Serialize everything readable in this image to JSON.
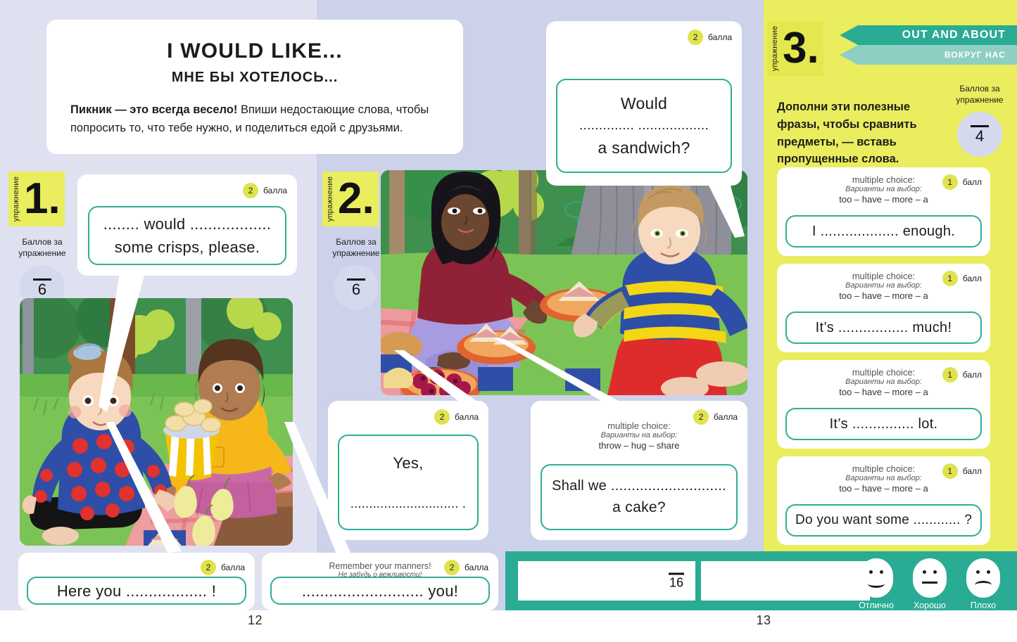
{
  "colors": {
    "bg_left": "#dfe1f0",
    "bg_right": "#ccd2ea",
    "yellow": "#e9ed5e",
    "teal": "#2aab94",
    "teal_light": "#8ecfc4",
    "answer_border": "#2fae96",
    "badge_dot": "#dfe34d",
    "score_circle": "#d5d9ee"
  },
  "pages": {
    "left_number": "12",
    "right_number": "13"
  },
  "title_card": {
    "title_en": "I WOULD LIKE...",
    "title_ru": "МНЕ БЫ ХОТЕЛОСЬ...",
    "body_bold": "Пикник — это всегда весело!",
    "body_rest": " Впиши недостающие слова, чтобы попросить то, что тебе нужно, и поделиться едой с друзьями."
  },
  "exercise1": {
    "vertical_label": "упражнение",
    "number": "1.",
    "caption": "Баллов за упражнение",
    "score_denominator": "6",
    "bubble": {
      "points_value": "2",
      "points_label": "балла",
      "line1": "........  would  ..................",
      "line2": "some crisps, please."
    }
  },
  "exercise2": {
    "vertical_label": "упражнение",
    "number": "2.",
    "caption": "Баллов за упражнение",
    "score_denominator": "6"
  },
  "exercise3": {
    "vertical_label": "упражнение",
    "number": "3.",
    "caption": "Баллов за упражнение",
    "score_denominator": "4",
    "ribbon_en": "OUT AND ABOUT",
    "ribbon_ru": "ВОКРУГ НАС",
    "instruction": "Дополни эти полезные фразы, чтобы сравнить предметы, — вставь пропущенные слова.",
    "cards": [
      {
        "mc_label_en": "multiple choice:",
        "mc_label_ru": "Варианты на выбор:",
        "options": "too – have – more – a",
        "points_value": "1",
        "points_label": "балл",
        "sentence": "I ................... enough."
      },
      {
        "mc_label_en": "multiple choice:",
        "mc_label_ru": "Варианты на выбор:",
        "options": "too – have – more – a",
        "points_value": "1",
        "points_label": "балл",
        "sentence": "It’s  .................  much!"
      },
      {
        "mc_label_en": "multiple choice:",
        "mc_label_ru": "Варианты на выбор:",
        "options": "too – have – more – a",
        "points_value": "1",
        "points_label": "балл",
        "sentence": "It’s ............... lot."
      },
      {
        "mc_label_en": "multiple choice:",
        "mc_label_ru": "Варианты на выбор:",
        "options": "too – have – more – a",
        "points_value": "1",
        "points_label": "балл",
        "sentence": "Do you want some ............ ?"
      }
    ]
  },
  "bubbles": {
    "sandwich": {
      "points_value": "2",
      "points_label": "балла",
      "line1": "Would",
      "line2": "..............   ..................",
      "line3": "a sandwich?"
    },
    "yes": {
      "points_value": "2",
      "points_label": "балла",
      "line1": "Yes,",
      "line2": "............................. ."
    },
    "cake": {
      "points_value": "2",
      "points_label": "балла",
      "mc_label_en": "multiple choice:",
      "mc_label_ru": "Варианты на выбор:",
      "options": "throw – hug – share",
      "line1": "Shall we ............................",
      "line2": "a cake?"
    },
    "here_you": {
      "points_value": "2",
      "points_label": "балла",
      "line1": "Here you .................. !"
    },
    "manners": {
      "points_value": "2",
      "points_label": "балла",
      "note_en": "Remember your manners!",
      "note_ru": "Не забудь о вежливости!",
      "line1": "........................... you!"
    }
  },
  "summary_bar": {
    "total_denominator": "16",
    "faces": [
      {
        "icon": "smiley-happy-icon",
        "label": "Отлично"
      },
      {
        "icon": "smiley-neutral-icon",
        "label": "Хорошо"
      },
      {
        "icon": "smiley-sad-icon",
        "label": "Плохо"
      }
    ]
  },
  "illustrations": {
    "left": {
      "name": "picnic-scene-crisps-illustration"
    },
    "center": {
      "name": "picnic-scene-sandwich-illustration"
    }
  }
}
